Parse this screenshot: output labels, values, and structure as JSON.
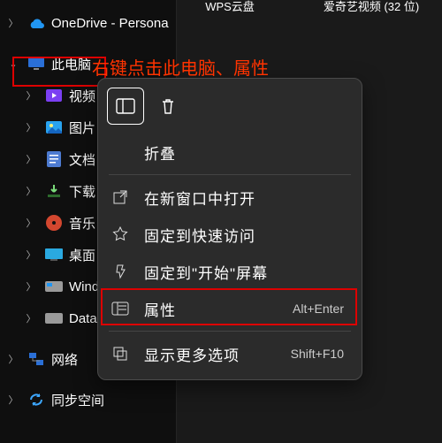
{
  "desktop": [
    {
      "label": "WPS云盘"
    },
    {
      "label": "爱奇艺视频 (32 位)"
    }
  ],
  "annotation": "右键点击此电脑、属性",
  "sidebar": {
    "onedrive": {
      "label": "OneDrive - Persona"
    },
    "this_pc": {
      "label": "此电脑"
    },
    "children": [
      {
        "label": "视频"
      },
      {
        "label": "图片"
      },
      {
        "label": "文档"
      },
      {
        "label": "下载"
      },
      {
        "label": "音乐"
      },
      {
        "label": "桌面"
      },
      {
        "label": "Wind"
      },
      {
        "label": "Data"
      }
    ],
    "network": {
      "label": "网络"
    },
    "sync": {
      "label": "同步空间"
    }
  },
  "ctx": {
    "collapse": {
      "label": "折叠"
    },
    "open_new": {
      "label": "在新窗口中打开"
    },
    "pin_quick": {
      "label": "固定到快速访问"
    },
    "pin_start": {
      "label": "固定到\"开始\"屏幕"
    },
    "properties": {
      "label": "属性",
      "shortcut": "Alt+Enter"
    },
    "show_more": {
      "label": "显示更多选项",
      "shortcut": "Shift+F10"
    }
  }
}
